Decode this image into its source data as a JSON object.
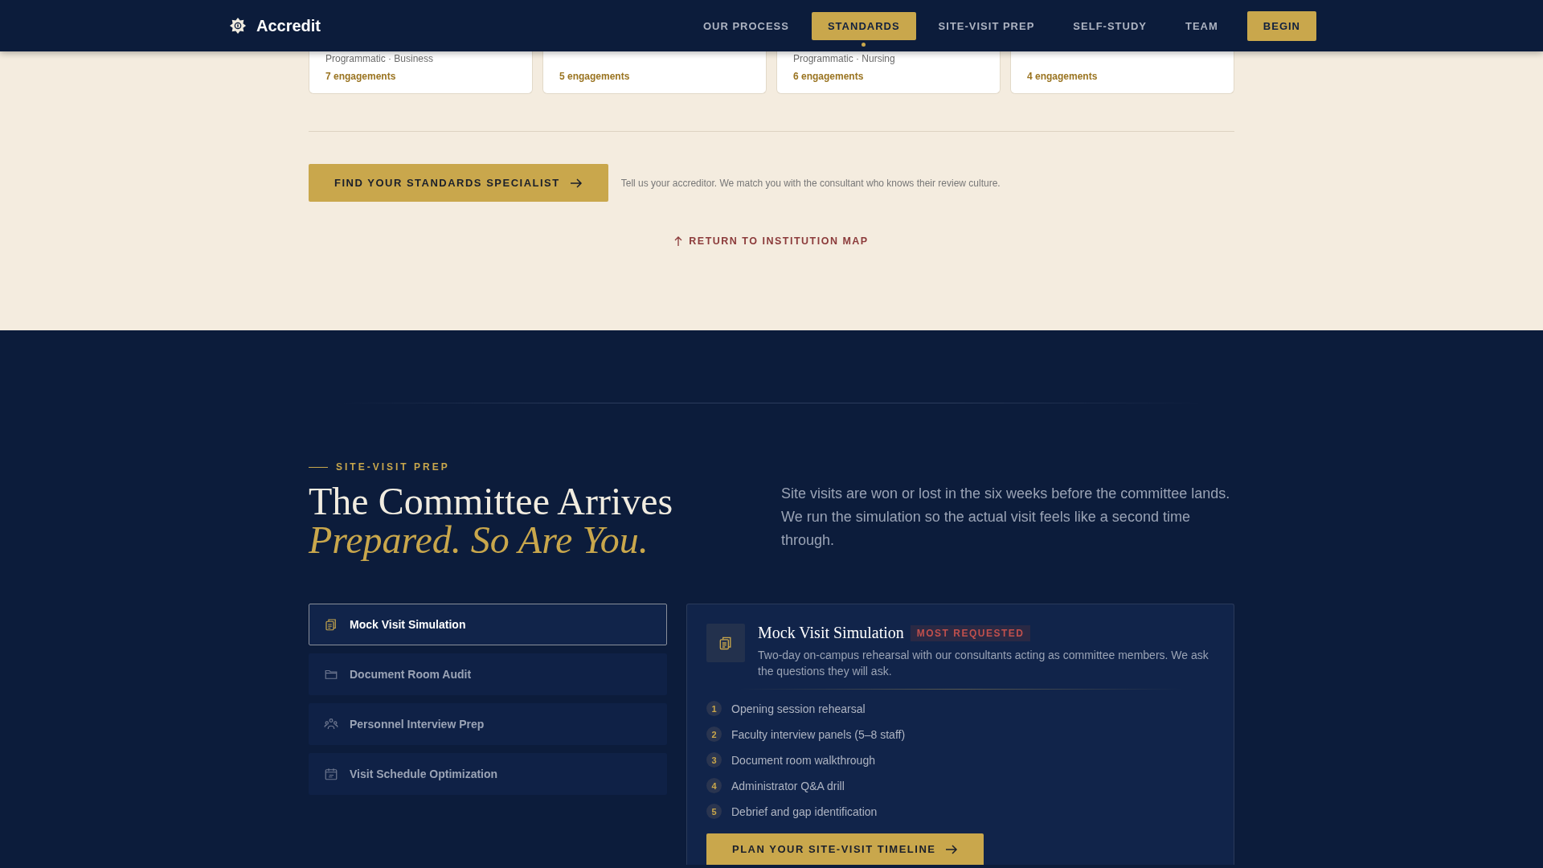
{
  "header": {
    "brand": "Accredit",
    "nav": [
      {
        "label": "OUR PROCESS",
        "selected": false
      },
      {
        "label": "STANDARDS",
        "selected": true
      },
      {
        "label": "SITE-VISIT PREP",
        "selected": false
      },
      {
        "label": "SELF-STUDY",
        "selected": false
      },
      {
        "label": "TEAM",
        "selected": false
      }
    ],
    "cta": "BEGIN"
  },
  "standards": {
    "cards": [
      {
        "subtitle": "Programmatic · Business",
        "engagements": "7 engagements"
      },
      {
        "engagements": "5 engagements"
      },
      {
        "subtitle": "Programmatic · Nursing",
        "engagements": "6 engagements"
      },
      {
        "engagements": "4 engagements"
      }
    ],
    "cta": {
      "label": "FIND YOUR STANDARDS SPECIALIST",
      "note": "Tell us your accreditor. We match you with the consultant who knows their review culture."
    },
    "return_link": "RETURN TO INSTITUTION MAP"
  },
  "site_visit": {
    "eyebrow": "SITE-VISIT PREP",
    "title": "The Committee Arrives",
    "title_accent": "Prepared. So Are You.",
    "intro": "Site visits are won or lost in the six weeks before the committee lands. We run the simulation so the actual visit feels like a second time through.",
    "services": [
      {
        "kind": "clipboard",
        "label": "Mock Visit Simulation",
        "selected": true
      },
      {
        "kind": "folder",
        "label": "Document Room Audit",
        "selected": false
      },
      {
        "kind": "people",
        "label": "Personnel Interview Prep",
        "selected": false
      },
      {
        "kind": "calendar",
        "label": "Visit Schedule Optimization",
        "selected": false
      }
    ],
    "detail": {
      "kind": "clipboard",
      "title": "Mock Visit Simulation",
      "badge": "MOST REQUESTED",
      "description": "Two-day on-campus rehearsal with our consultants acting as committee members. We ask the questions they will ask.",
      "steps": [
        {
          "number": "1",
          "text": "Opening session rehearsal"
        },
        {
          "number": "2",
          "text": "Faculty interview panels (5–8 staff)"
        },
        {
          "number": "3",
          "text": "Document room walkthrough"
        },
        {
          "number": "4",
          "text": "Administrator Q&A drill"
        },
        {
          "number": "5",
          "text": "Debrief and gap identification"
        }
      ],
      "button": "PLAN YOUR SITE-VISIT TIMELINE"
    }
  }
}
